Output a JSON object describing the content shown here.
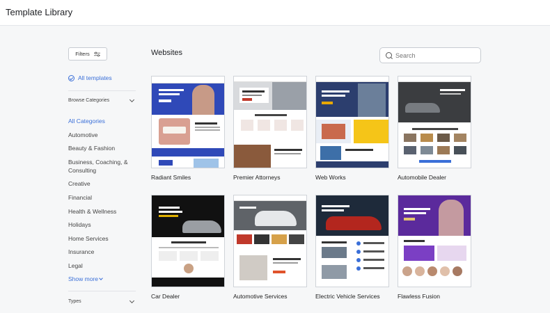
{
  "app": {
    "title": "Template Library"
  },
  "sidebar": {
    "filters_label": "Filters",
    "all_templates_label": "All templates",
    "browse_categories_label": "Browse Categories",
    "categories": [
      {
        "label": "All Categories",
        "active": true
      },
      {
        "label": "Automotive"
      },
      {
        "label": "Beauty & Fashion"
      },
      {
        "label": "Business, Coaching, & Consulting"
      },
      {
        "label": "Creative"
      },
      {
        "label": "Financial"
      },
      {
        "label": "Health & Wellness"
      },
      {
        "label": "Holidays"
      },
      {
        "label": "Home Services"
      },
      {
        "label": "Insurance"
      },
      {
        "label": "Legal"
      }
    ],
    "show_more_label": "Show more",
    "types_label": "Types"
  },
  "main": {
    "section_title": "Websites",
    "search": {
      "placeholder": "Search",
      "value": ""
    },
    "templates": [
      {
        "name": "Radiant Smiles"
      },
      {
        "name": "Premier Attorneys"
      },
      {
        "name": "Web Works"
      },
      {
        "name": "Automobile Dealer"
      },
      {
        "name": "Car Dealer"
      },
      {
        "name": "Automotive Services"
      },
      {
        "name": "Electric Vehicle Services"
      },
      {
        "name": "Flawless Fusion"
      }
    ]
  },
  "colors": {
    "accent": "#3a6fd8",
    "page_bg": "#f6f7f8",
    "topbar_bg": "#ffffff"
  }
}
